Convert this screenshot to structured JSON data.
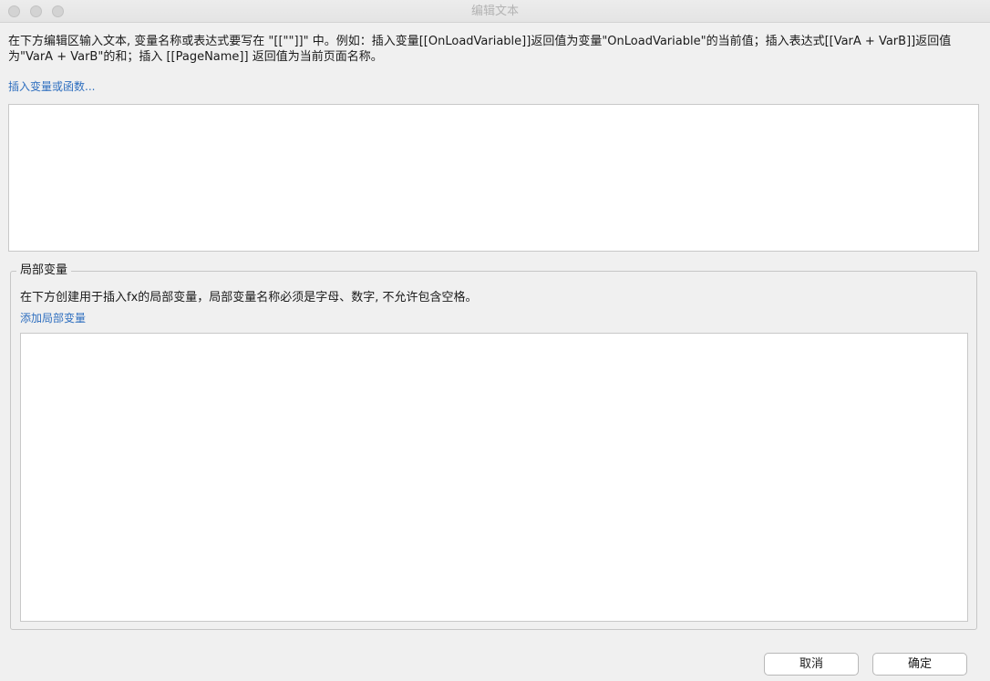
{
  "window": {
    "title": "编辑文本"
  },
  "instructions": {
    "text": "在下方编辑区输入文本, 变量名称或表达式要写在 \"[[\"\"]]\" 中。例如：插入变量[[OnLoadVariable]]返回值为变量\"OnLoadVariable\"的当前值；插入表达式[[VarA + VarB]]返回值为\"VarA + VarB\"的和；插入 [[PageName]] 返回值为当前页面名称。"
  },
  "editor": {
    "insert_link": "插入变量或函数...",
    "value": ""
  },
  "local_vars": {
    "legend": "局部变量",
    "description": "在下方创建用于插入fx的局部变量，局部变量名称必须是字母、数字, 不允许包含空格。",
    "add_link": "添加局部变量",
    "items": []
  },
  "footer": {
    "cancel_label": "取消",
    "ok_label": "确定"
  }
}
